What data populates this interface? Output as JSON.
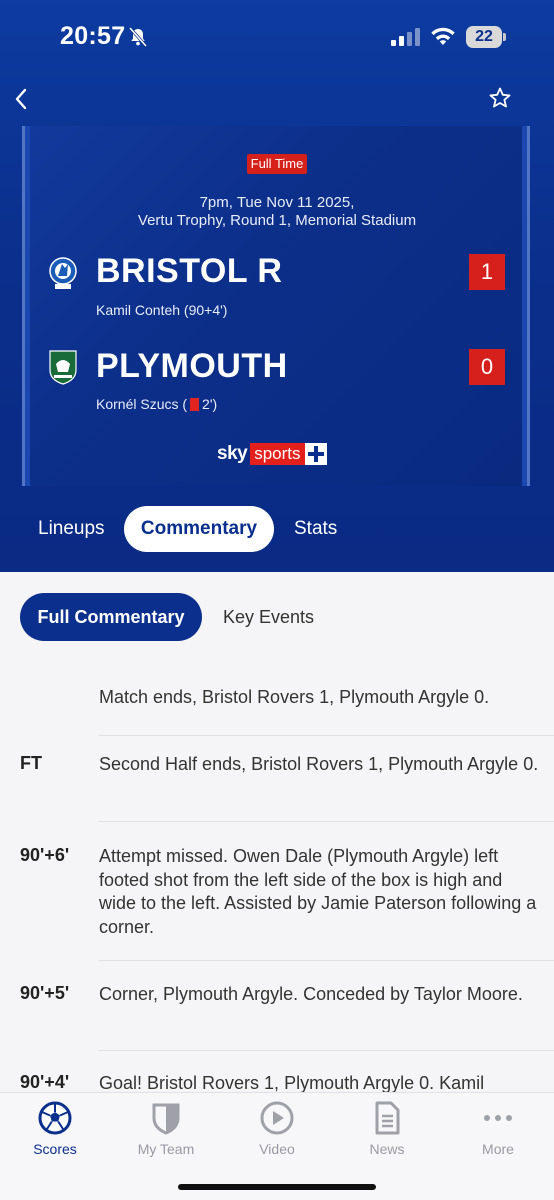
{
  "status_bar": {
    "time": "20:57",
    "battery": "22"
  },
  "match": {
    "status_badge": "Full Time",
    "datetime": "7pm, Tue Nov 11 2025,",
    "competition_venue": "Vertu Trophy, Round 1, Memorial Stadium",
    "home": {
      "name": "BRISTOL R",
      "score": "1",
      "event": "Kamil Conteh (90+4')"
    },
    "away": {
      "name": "PLYMOUTH",
      "score": "0",
      "event_player": "Kornél Szucs (",
      "event_minute": "2')"
    },
    "broadcaster": {
      "sky": "sky",
      "sports": "sports"
    }
  },
  "tabs": [
    {
      "label": "Lineups"
    },
    {
      "label": "Commentary",
      "active": true
    },
    {
      "label": "Stats"
    }
  ],
  "subtabs": [
    {
      "label": "Full Commentary",
      "active": true
    },
    {
      "label": "Key Events"
    }
  ],
  "commentary": [
    {
      "minute": "",
      "text": "Match ends, Bristol Rovers 1, Plymouth Argyle 0."
    },
    {
      "minute": "FT",
      "text": "Second Half ends, Bristol Rovers 1, Plymouth Argyle 0."
    },
    {
      "minute": "90'+6'",
      "text": "Attempt missed. Owen Dale (Plymouth Argyle) left footed shot from the left side of the box is high and wide to the left. Assisted by Jamie Paterson following a corner."
    },
    {
      "minute": "90'+5'",
      "text": "Corner, Plymouth Argyle. Conceded by Taylor Moore."
    },
    {
      "minute": "90'+4'",
      "text": "Goal! Bristol Rovers 1, Plymouth Argyle 0. Kamil"
    }
  ],
  "bottom_nav": [
    {
      "label": "Scores",
      "icon": "football-icon",
      "active": true
    },
    {
      "label": "My Team",
      "icon": "shield-icon"
    },
    {
      "label": "Video",
      "icon": "play-icon"
    },
    {
      "label": "News",
      "icon": "document-icon"
    },
    {
      "label": "More",
      "icon": "more-icon"
    }
  ],
  "colors": {
    "primary": "#0b2f8c",
    "accent_red": "#d6201b",
    "content_bg": "#f5f5f7"
  }
}
